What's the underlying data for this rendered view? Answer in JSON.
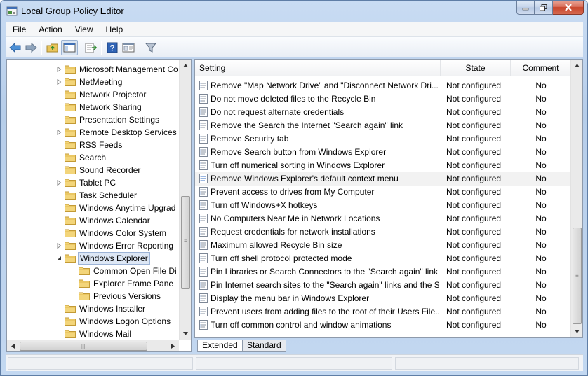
{
  "window": {
    "title": "Local Group Policy Editor"
  },
  "menu": {
    "items": [
      "File",
      "Action",
      "View",
      "Help"
    ]
  },
  "toolbar": {
    "icons": [
      "back-arrow-icon",
      "forward-arrow-icon",
      "up-folder-icon",
      "show-hide-tree-icon",
      "export-list-icon",
      "help-icon",
      "properties-icon",
      "filter-icon"
    ]
  },
  "tree": {
    "items": [
      {
        "label": "Microsoft Management Co",
        "expander": "collapsed",
        "depth": 0
      },
      {
        "label": "NetMeeting",
        "expander": "collapsed",
        "depth": 0
      },
      {
        "label": "Network Projector",
        "expander": "none",
        "depth": 0
      },
      {
        "label": "Network Sharing",
        "expander": "none",
        "depth": 0
      },
      {
        "label": "Presentation Settings",
        "expander": "none",
        "depth": 0
      },
      {
        "label": "Remote Desktop Services",
        "expander": "collapsed",
        "depth": 0
      },
      {
        "label": "RSS Feeds",
        "expander": "none",
        "depth": 0
      },
      {
        "label": "Search",
        "expander": "none",
        "depth": 0
      },
      {
        "label": "Sound Recorder",
        "expander": "none",
        "depth": 0
      },
      {
        "label": "Tablet PC",
        "expander": "collapsed",
        "depth": 0
      },
      {
        "label": "Task Scheduler",
        "expander": "none",
        "depth": 0
      },
      {
        "label": "Windows Anytime Upgrad",
        "expander": "none",
        "depth": 0
      },
      {
        "label": "Windows Calendar",
        "expander": "none",
        "depth": 0
      },
      {
        "label": "Windows Color System",
        "expander": "none",
        "depth": 0
      },
      {
        "label": "Windows Error Reporting",
        "expander": "collapsed",
        "depth": 0
      },
      {
        "label": "Windows Explorer",
        "expander": "expanded",
        "depth": 0,
        "selected": true
      },
      {
        "label": "Common Open File Di",
        "expander": "none",
        "depth": 1
      },
      {
        "label": "Explorer Frame Pane",
        "expander": "none",
        "depth": 1
      },
      {
        "label": "Previous Versions",
        "expander": "none",
        "depth": 1
      },
      {
        "label": "Windows Installer",
        "expander": "none",
        "depth": 0
      },
      {
        "label": "Windows Logon Options",
        "expander": "none",
        "depth": 0
      },
      {
        "label": "Windows Mail",
        "expander": "none",
        "depth": 0
      }
    ]
  },
  "list": {
    "columns": {
      "setting": "Setting",
      "state": "State",
      "comment": "Comment"
    },
    "rows": [
      {
        "setting": "Remove \"Map Network Drive\" and \"Disconnect Network Dri...",
        "state": "Not configured",
        "comment": "No"
      },
      {
        "setting": "Do not move deleted files to the Recycle Bin",
        "state": "Not configured",
        "comment": "No"
      },
      {
        "setting": "Do not request alternate credentials",
        "state": "Not configured",
        "comment": "No"
      },
      {
        "setting": "Remove the Search the Internet \"Search again\" link",
        "state": "Not configured",
        "comment": "No"
      },
      {
        "setting": "Remove Security tab",
        "state": "Not configured",
        "comment": "No"
      },
      {
        "setting": "Remove Search button from Windows Explorer",
        "state": "Not configured",
        "comment": "No"
      },
      {
        "setting": "Turn off numerical sorting in Windows Explorer",
        "state": "Not configured",
        "comment": "No"
      },
      {
        "setting": "Remove Windows Explorer's default context menu",
        "state": "Not configured",
        "comment": "No",
        "highlight": true
      },
      {
        "setting": "Prevent access to drives from My Computer",
        "state": "Not configured",
        "comment": "No"
      },
      {
        "setting": "Turn off Windows+X hotkeys",
        "state": "Not configured",
        "comment": "No"
      },
      {
        "setting": "No Computers Near Me in Network Locations",
        "state": "Not configured",
        "comment": "No"
      },
      {
        "setting": "Request credentials for network installations",
        "state": "Not configured",
        "comment": "No"
      },
      {
        "setting": "Maximum allowed Recycle Bin size",
        "state": "Not configured",
        "comment": "No"
      },
      {
        "setting": "Turn off shell protocol protected mode",
        "state": "Not configured",
        "comment": "No"
      },
      {
        "setting": "Pin Libraries or Search Connectors to the \"Search again\" link...",
        "state": "Not configured",
        "comment": "No"
      },
      {
        "setting": "Pin Internet search sites to the \"Search again\" links and the S...",
        "state": "Not configured",
        "comment": "No"
      },
      {
        "setting": "Display the menu bar in Windows Explorer",
        "state": "Not configured",
        "comment": "No"
      },
      {
        "setting": "Prevent users from adding files to the root of their Users File...",
        "state": "Not configured",
        "comment": "No"
      },
      {
        "setting": "Turn off common control and window animations",
        "state": "Not configured",
        "comment": "No"
      }
    ]
  },
  "tabs": {
    "extended": "Extended",
    "standard": "Standard"
  },
  "colors": {
    "selection": "#dde7f5",
    "title_bar": "#c3d8f1",
    "close_button": "#c8452b"
  }
}
